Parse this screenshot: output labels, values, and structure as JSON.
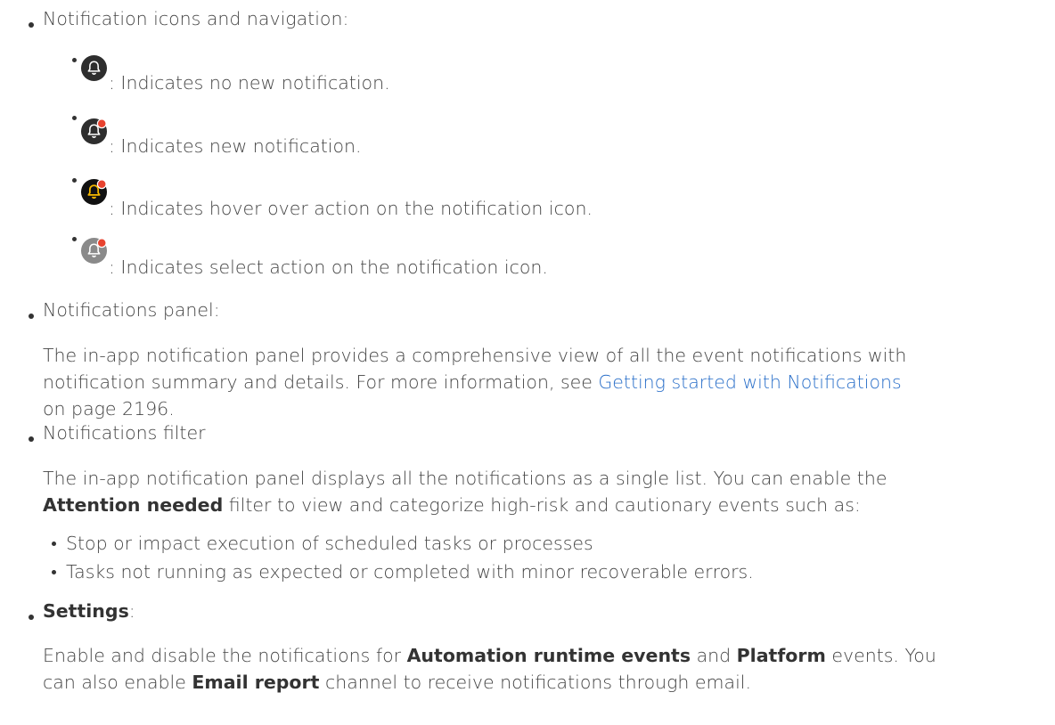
{
  "icons_section": {
    "heading": "Notification icons and navigation:",
    "items": [
      {
        "icon": "bell-icon-no-new",
        "text": ": Indicates no new notification."
      },
      {
        "icon": "bell-icon-new",
        "text": ": Indicates new notification."
      },
      {
        "icon": "bell-icon-hover",
        "text": ": Indicates hover over action on the notification icon."
      },
      {
        "icon": "bell-icon-select",
        "text": ": Indicates select action on the notification icon."
      }
    ]
  },
  "panel_section": {
    "heading": "Notifications panel:",
    "line1": "The in-app notification panel provides a comprehensive view of all the event notifications with",
    "line2_prefix": "notification summary and details. For more information, see ",
    "line2_link": "Getting started with Notifications",
    "line3": "on page 2196."
  },
  "filter_section": {
    "heading": "Notifications filter",
    "line1": "The in-app notification panel displays all the notifications as a single list. You can enable the",
    "line2_bold": "Attention needed",
    "line2_rest": " filter to view and categorize high-risk and cautionary events such as:",
    "subitems": [
      "Stop or impact execution of scheduled tasks or processes",
      "Tasks not running as expected or completed with minor recoverable errors."
    ]
  },
  "settings_section": {
    "heading_bold": "Settings",
    "heading_rest": ":",
    "line1_a": "Enable and disable the notifications for ",
    "line1_b": "Automation runtime events",
    "line1_c": " and ",
    "line1_d": "Platform",
    "line1_e": " events. You",
    "line2_a": "can also enable ",
    "line2_b": "Email report",
    "line2_c": " channel to receive notifications through email."
  },
  "colors": {
    "text": "#444444",
    "link": "#2a6fc9",
    "bell_dark": "#2e2e2e",
    "bell_hover_bg": "#111111",
    "bell_hover_glyph": "#f5b800",
    "bell_select": "#8a8a8a",
    "badge_red": "#e8432f"
  }
}
